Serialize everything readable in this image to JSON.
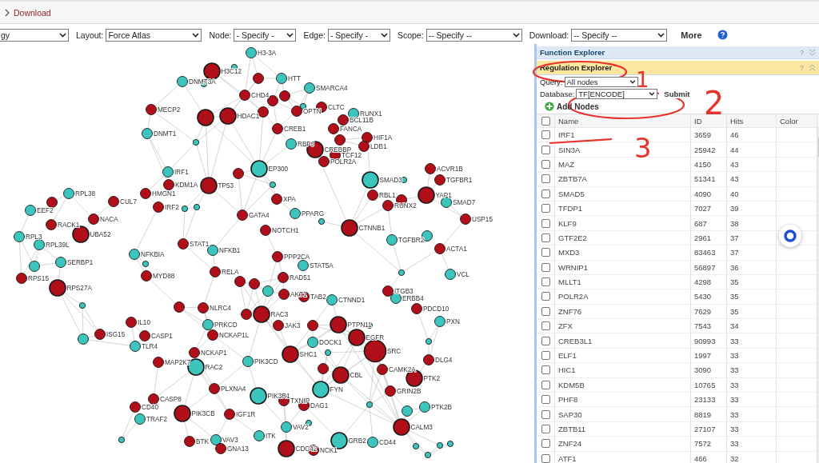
{
  "breadcrumb": {
    "item": "Download"
  },
  "toolbar": {
    "controls": [
      {
        "value": "gy"
      },
      {
        "label": "Layout:",
        "value": "Force Atlas"
      },
      {
        "label": "Node:",
        "value": "- Specify -"
      },
      {
        "label": "Edge:",
        "value": "- Specify -"
      },
      {
        "label": "Scope:",
        "value": "-- Specify --"
      },
      {
        "label": "Download:",
        "value": "-- Specify --"
      }
    ],
    "more": "More"
  },
  "graph": {
    "nodes": [
      {
        "label": "H3-3A",
        "color": "#3cc5bd",
        "kind": "node"
      },
      {
        "label": "H3C12",
        "color": "#b00e18",
        "kind": "hub"
      },
      {
        "label": "DNMT3A",
        "color": "#3cc5bd",
        "kind": "node"
      },
      {
        "color": "#3cc5bd",
        "kind": "dot"
      },
      {
        "color": "#3cc5bd",
        "kind": "dot"
      },
      {
        "color": "#b00e18",
        "kind": "node"
      },
      {
        "label": "HTT",
        "color": "#3cc5bd",
        "kind": "node"
      },
      {
        "label": "CHD4",
        "color": "#b00e18",
        "kind": "node"
      },
      {
        "label": "MECP2",
        "color": "#b00e18",
        "kind": "node"
      },
      {
        "color": "#b00e18",
        "kind": "hub"
      },
      {
        "label": "HDAC1",
        "color": "#b00e18",
        "kind": "hub"
      },
      {
        "label": "DNMT1",
        "color": "#3cc5bd",
        "kind": "node"
      },
      {
        "color": "#3cc5bd",
        "kind": "dot"
      },
      {
        "label": "IRF1",
        "color": "#3cc5bd",
        "kind": "node"
      },
      {
        "label": "EP300",
        "color": "#3cc5bd",
        "kind": "hub"
      },
      {
        "color": "#b00e18",
        "kind": "node"
      },
      {
        "label": "KDM1A",
        "color": "#b00e18",
        "kind": "node"
      },
      {
        "label": "TP53",
        "color": "#b00e18",
        "kind": "hub"
      },
      {
        "label": "RPL38",
        "color": "#3cc5bd",
        "kind": "node"
      },
      {
        "label": "HMGN1",
        "color": "#b00e18",
        "kind": "node"
      },
      {
        "label": "CUL7",
        "color": "#b00e18",
        "kind": "node"
      },
      {
        "color": "#b00e18",
        "kind": "node"
      },
      {
        "label": "EEF2",
        "color": "#3cc5bd",
        "kind": "node"
      },
      {
        "label": "IRF2",
        "color": "#b00e18",
        "kind": "node"
      },
      {
        "color": "#3cc5bd",
        "kind": "dot"
      },
      {
        "color": "#3cc5bd",
        "kind": "dot"
      },
      {
        "label": "RACK1",
        "color": "#b00e18",
        "kind": "node"
      },
      {
        "label": "NACA",
        "color": "#b00e18",
        "kind": "node"
      },
      {
        "label": "UBA52",
        "color": "#b00e18",
        "kind": "hub"
      },
      {
        "label": "RPL3",
        "color": "#3cc5bd",
        "kind": "node"
      },
      {
        "label": "RPL39L",
        "color": "#3cc5bd",
        "kind": "node"
      },
      {
        "label": "STAT1",
        "color": "#b00e18",
        "kind": "node"
      },
      {
        "label": "NFKB1",
        "color": "#3cc5bd",
        "kind": "node"
      },
      {
        "label": "NFKBIA",
        "color": "#3cc5bd",
        "kind": "node"
      },
      {
        "label": "SERBP1",
        "color": "#3cc5bd",
        "kind": "node"
      },
      {
        "color": "#3cc5bd",
        "kind": "node"
      },
      {
        "color": "#3cc5bd",
        "kind": "dot"
      },
      {
        "label": "RPS15",
        "color": "#b00e18",
        "kind": "node"
      },
      {
        "label": "MYD88",
        "color": "#b00e18",
        "kind": "node"
      },
      {
        "label": "RELA",
        "color": "#b00e18",
        "kind": "node"
      },
      {
        "label": "RPS27A",
        "color": "#b00e18",
        "kind": "hub"
      },
      {
        "label": "SMARCA4",
        "color": "#3cc5bd",
        "kind": "node"
      },
      {
        "color": "#b00e18",
        "kind": "node"
      },
      {
        "color": "#b00e18",
        "kind": "node"
      },
      {
        "color": "#3cc5bd",
        "kind": "dot"
      },
      {
        "color": "#b00e18",
        "kind": "node"
      },
      {
        "label": "OPTN",
        "color": "#b00e18",
        "kind": "node"
      },
      {
        "label": "CLTC",
        "color": "#b00e18",
        "kind": "node"
      },
      {
        "label": "RUNX1",
        "color": "#3cc5bd",
        "kind": "node"
      },
      {
        "label": "BCL11B",
        "color": "#b00e18",
        "kind": "node"
      },
      {
        "label": "CREB1",
        "color": "#b00e18",
        "kind": "node"
      },
      {
        "label": "FANCA",
        "color": "#b00e18",
        "kind": "node"
      },
      {
        "color": "#b00e18",
        "kind": "node"
      },
      {
        "label": "HIF1A",
        "color": "#b00e18",
        "kind": "node"
      },
      {
        "label": "LDB1",
        "color": "#b00e18",
        "kind": "node"
      },
      {
        "label": "RBPJ",
        "color": "#3cc5bd",
        "kind": "node"
      },
      {
        "label": "CREBBP",
        "color": "#b00e18",
        "kind": "hub"
      },
      {
        "label": "TCF12",
        "color": "#b00e18",
        "kind": "node"
      },
      {
        "label": "POLR2A",
        "color": "#b00e18",
        "kind": "node"
      },
      {
        "label": "SMAD3",
        "color": "#3cc5bd",
        "kind": "hub"
      },
      {
        "color": "#3cc5bd",
        "kind": "dot"
      },
      {
        "label": "ACVR1B",
        "color": "#b00e18",
        "kind": "node"
      },
      {
        "label": "TGFBR1",
        "color": "#b00e18",
        "kind": "node"
      },
      {
        "color": "#3cc5bd",
        "kind": "dot"
      },
      {
        "label": "RBL1",
        "color": "#b00e18",
        "kind": "node"
      },
      {
        "label": "RUNX2",
        "color": "#b00e18",
        "kind": "node"
      },
      {
        "color": "#b00e18",
        "kind": "node"
      },
      {
        "label": "YAP1",
        "color": "#b00e18",
        "kind": "hub"
      },
      {
        "label": "SMAD7",
        "color": "#3cc5bd",
        "kind": "node"
      },
      {
        "label": "XPA",
        "color": "#b00e18",
        "kind": "node"
      },
      {
        "label": "GATA4",
        "color": "#b00e18",
        "kind": "node"
      },
      {
        "label": "PPARG",
        "color": "#3cc5bd",
        "kind": "node"
      },
      {
        "label": "USP15",
        "color": "#b00e18",
        "kind": "node"
      },
      {
        "color": "#3cc5bd",
        "kind": "dot"
      },
      {
        "label": "NOTCH1",
        "color": "#b00e18",
        "kind": "node"
      },
      {
        "label": "CTNNB1",
        "color": "#b00e18",
        "kind": "hub"
      },
      {
        "label": "TGFBR2",
        "color": "#3cc5bd",
        "kind": "node"
      },
      {
        "color": "#3cc5bd",
        "kind": "node"
      },
      {
        "label": "ACTA1",
        "color": "#b00e18",
        "kind": "node"
      },
      {
        "label": "PPP2CA",
        "color": "#b00e18",
        "kind": "node"
      },
      {
        "label": "STAT5A",
        "color": "#3cc5bd",
        "kind": "node"
      },
      {
        "label": "RAD51",
        "color": "#b00e18",
        "kind": "node"
      },
      {
        "color": "#3cc5bd",
        "kind": "dot"
      },
      {
        "label": "VCL",
        "color": "#3cc5bd",
        "kind": "node"
      },
      {
        "color": "#b00e18",
        "kind": "node"
      },
      {
        "color": "#b00e18",
        "kind": "node"
      },
      {
        "color": "#3cc5bd",
        "kind": "node"
      },
      {
        "label": "AKT1",
        "color": "#b00e18",
        "kind": "node"
      },
      {
        "label": "TAB2",
        "color": "#b00e18",
        "kind": "node"
      },
      {
        "label": "CTNND1",
        "color": "#3cc5bd",
        "kind": "node"
      },
      {
        "label": "ITGB3",
        "color": "#b00e18",
        "kind": "node"
      },
      {
        "label": "ERBB4",
        "color": "#3cc5bd",
        "kind": "node"
      },
      {
        "label": "PDCD10",
        "color": "#b00e18",
        "kind": "node"
      },
      {
        "color": "#b00e18",
        "kind": "node"
      },
      {
        "label": "NLRC4",
        "color": "#b00e18",
        "kind": "node"
      },
      {
        "label": "RAC3",
        "color": "#b00e18",
        "kind": "hub"
      },
      {
        "color": "#b00e18",
        "kind": "node"
      },
      {
        "label": "IL10",
        "color": "#b00e18",
        "kind": "node"
      },
      {
        "label": "PRKCD",
        "color": "#3cc5bd",
        "kind": "node"
      },
      {
        "label": "JAK3",
        "color": "#b00e18",
        "kind": "node"
      },
      {
        "color": "#b00e18",
        "kind": "node"
      },
      {
        "label": "PTPN11",
        "color": "#b00e18",
        "kind": "hub"
      },
      {
        "label": "PXN",
        "color": "#3cc5bd",
        "kind": "node"
      },
      {
        "label": "ISG15",
        "color": "#b00e18",
        "kind": "node"
      },
      {
        "label": "CASP1",
        "color": "#b00e18",
        "kind": "node"
      },
      {
        "label": "NCKAP1L",
        "color": "#b00e18",
        "kind": "node"
      },
      {
        "color": "#3cc5bd",
        "kind": "node"
      },
      {
        "label": "EGFR",
        "color": "#b00e18",
        "kind": "hub"
      },
      {
        "label": "DOCK1",
        "color": "#3cc5bd",
        "kind": "node"
      },
      {
        "label": "TLR4",
        "color": "#3cc5bd",
        "kind": "node"
      },
      {
        "label": "NCKAP1",
        "color": "#b00e18",
        "kind": "node"
      },
      {
        "label": "SHC1",
        "color": "#b00e18",
        "kind": "hub"
      },
      {
        "label": "SRC",
        "color": "#b00e18",
        "kind": "big"
      },
      {
        "label": "MAP2K7",
        "color": "#b00e18",
        "kind": "node"
      },
      {
        "label": "RAC2",
        "color": "#3cc5bd",
        "kind": "hub"
      },
      {
        "label": "PIK3CD",
        "color": "#3cc5bd",
        "kind": "node"
      },
      {
        "label": "DLG4",
        "color": "#b00e18",
        "kind": "node"
      },
      {
        "color": "#b00e18",
        "kind": "node"
      },
      {
        "label": "CBL",
        "color": "#b00e18",
        "kind": "hub"
      },
      {
        "label": "CAMK2A",
        "color": "#b00e18",
        "kind": "node"
      },
      {
        "label": "PTK2",
        "color": "#b00e18",
        "kind": "hub"
      },
      {
        "label": "PLXNA4",
        "color": "#b00e18",
        "kind": "node"
      },
      {
        "label": "FYN",
        "color": "#3cc5bd",
        "kind": "hub"
      },
      {
        "label": "PIK3R1",
        "color": "#3cc5bd",
        "kind": "hub"
      },
      {
        "label": "GRIN2B",
        "color": "#b00e18",
        "kind": "node"
      },
      {
        "label": "CASP8",
        "color": "#b00e18",
        "kind": "node"
      },
      {
        "label": "TXNIP",
        "color": "#b00e18",
        "kind": "node"
      },
      {
        "label": "CD40",
        "color": "#b00e18",
        "kind": "node"
      },
      {
        "label": "DAG1",
        "color": "#b00e18",
        "kind": "node"
      },
      {
        "color": "#3cc5bd",
        "kind": "node"
      },
      {
        "label": "PTK2B",
        "color": "#3cc5bd",
        "kind": "node"
      },
      {
        "label": "PIK3CB",
        "color": "#b00e18",
        "kind": "hub"
      },
      {
        "label": "IGF1R",
        "color": "#b00e18",
        "kind": "node"
      },
      {
        "label": "TRAF2",
        "color": "#3cc5bd",
        "kind": "node"
      },
      {
        "label": "VAV2",
        "color": "#3cc5bd",
        "kind": "node"
      },
      {
        "label": "CALM3",
        "color": "#b00e18",
        "kind": "hub"
      },
      {
        "label": "BTK",
        "color": "#b00e18",
        "kind": "node"
      },
      {
        "label": "VAV3",
        "color": "#3cc5bd",
        "kind": "node"
      },
      {
        "label": "ITK",
        "color": "#3cc5bd",
        "kind": "node"
      },
      {
        "label": "GRB2",
        "color": "#3cc5bd",
        "kind": "hub"
      },
      {
        "label": "CD44",
        "color": "#3cc5bd",
        "kind": "node"
      },
      {
        "label": "GNA13",
        "color": "#b00e18",
        "kind": "node"
      },
      {
        "label": "CDC42",
        "color": "#b00e18",
        "kind": "hub"
      },
      {
        "label": "NCK1",
        "color": "#b00e18",
        "kind": "node"
      },
      {
        "color": "#3cc5bd",
        "kind": "dot"
      },
      {
        "color": "#3cc5bd",
        "kind": "dot"
      },
      {
        "color": "#3cc5bd",
        "kind": "dot"
      },
      {
        "color": "#3cc5bd",
        "kind": "dot"
      },
      {
        "color": "#3cc5bd",
        "kind": "dot"
      },
      {
        "color": "#3cc5bd",
        "kind": "dot"
      },
      {
        "color": "#3cc5bd",
        "kind": "dot"
      },
      {
        "color": "#3cc5bd",
        "kind": "dot"
      },
      {
        "color": "#3cc5bd",
        "kind": "dot"
      },
      {
        "color": "#3cc5bd",
        "kind": "dot"
      },
      {
        "color": "#3cc5bd",
        "kind": "dot"
      }
    ]
  },
  "panels": [
    {
      "title": "Function Explorer",
      "help": "?",
      "expanded": false
    },
    {
      "title": "Regulation Explorer",
      "help": "?",
      "expanded": true
    }
  ],
  "regulation": {
    "query_label": "Query:",
    "query_value": "All nodes",
    "database_label": "Database:",
    "database_value": "TF[ENCODE]",
    "submit": "Submit",
    "add_nodes": "Add Nodes",
    "table": {
      "columns": [
        "Name",
        "ID",
        "Hits",
        "Color"
      ],
      "all_checked": false,
      "rows": [
        {
          "name": "IRF1",
          "id": "3659",
          "hits": "46",
          "checked": false
        },
        {
          "name": "SIN3A",
          "id": "25942",
          "hits": "44",
          "checked": false
        },
        {
          "name": "MAZ",
          "id": "4150",
          "hits": "43",
          "checked": false
        },
        {
          "name": "ZBTB7A",
          "id": "51341",
          "hits": "43",
          "checked": false
        },
        {
          "name": "SMAD5",
          "id": "4090",
          "hits": "40",
          "checked": false
        },
        {
          "name": "TFDP1",
          "id": "7027",
          "hits": "39",
          "checked": false
        },
        {
          "name": "KLF9",
          "id": "687",
          "hits": "38",
          "checked": false
        },
        {
          "name": "GTF2E2",
          "id": "2961",
          "hits": "37",
          "checked": false
        },
        {
          "name": "MXD3",
          "id": "83463",
          "hits": "37",
          "checked": false
        },
        {
          "name": "WRNIP1",
          "id": "56897",
          "hits": "36",
          "checked": false
        },
        {
          "name": "MLLT1",
          "id": "4298",
          "hits": "35",
          "checked": false
        },
        {
          "name": "POLR2A",
          "id": "5430",
          "hits": "35",
          "checked": false
        },
        {
          "name": "ZNF76",
          "id": "7629",
          "hits": "35",
          "checked": false
        },
        {
          "name": "ZFX",
          "id": "7543",
          "hits": "34",
          "checked": false
        },
        {
          "name": "CREB3L1",
          "id": "90993",
          "hits": "33",
          "checked": false
        },
        {
          "name": "ELF1",
          "id": "1997",
          "hits": "33",
          "checked": false
        },
        {
          "name": "HIC1",
          "id": "3090",
          "hits": "33",
          "checked": false
        },
        {
          "name": "KDM5B",
          "id": "10765",
          "hits": "33",
          "checked": false
        },
        {
          "name": "PHF8",
          "id": "23133",
          "hits": "33",
          "checked": false
        },
        {
          "name": "SAP30",
          "id": "8819",
          "hits": "33",
          "checked": false
        },
        {
          "name": "ZBTB11",
          "id": "27107",
          "hits": "33",
          "checked": false
        },
        {
          "name": "ZNF24",
          "id": "7572",
          "hits": "33",
          "checked": false
        },
        {
          "name": "ATF1",
          "id": "466",
          "hits": "32",
          "checked": false
        }
      ]
    }
  },
  "annotations": [
    {
      "kind": "ellipse",
      "number": "1"
    },
    {
      "kind": "ellipse",
      "number": "2"
    },
    {
      "kind": "line",
      "number": "3"
    }
  ]
}
